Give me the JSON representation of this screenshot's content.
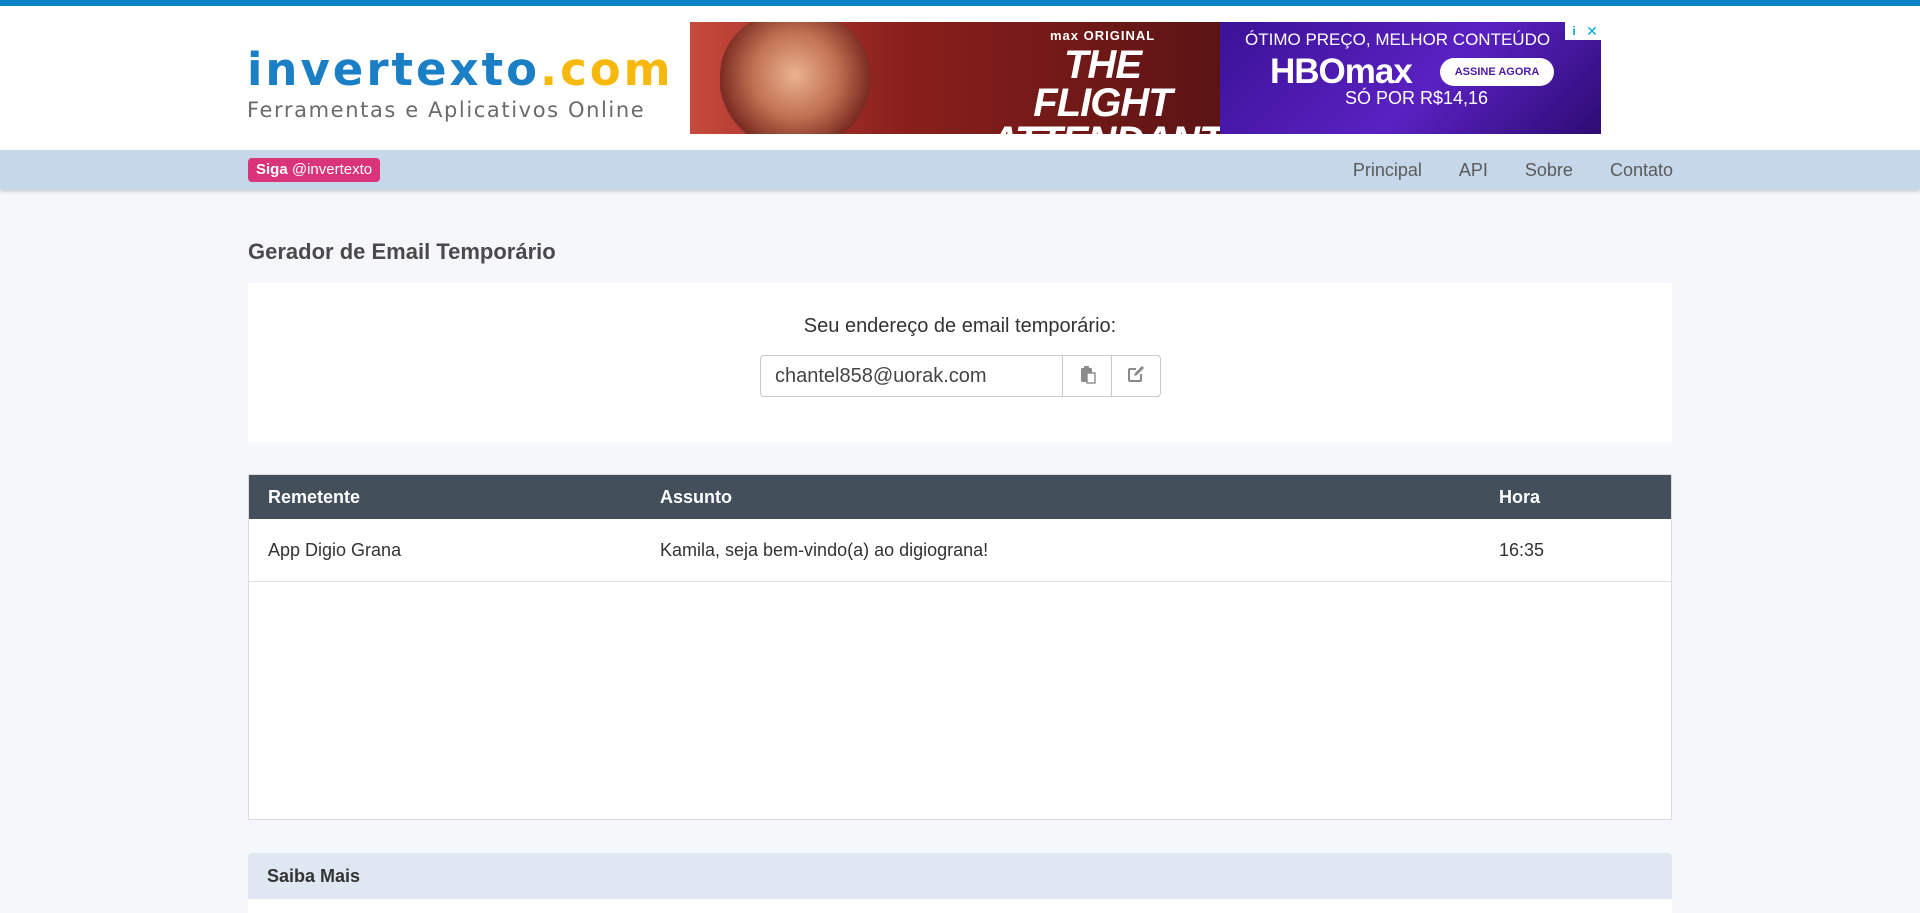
{
  "site": {
    "logo_part1": "invertexto",
    "logo_part2": ".com",
    "tagline": "Ferramentas e Aplicativos Online"
  },
  "ad": {
    "top_label": "max ORIGINAL",
    "show_title": "THE FLIGHT ATTENDANT",
    "promo": "ÓTIMO PREÇO, MELHOR CONTEÚDO",
    "brand": "HBOmax",
    "cta": "ASSINE AGORA",
    "price": "SÓ POR R$14,16",
    "info_icon": "info-icon",
    "close_icon": "close-icon"
  },
  "navbar": {
    "follow_bold": "Siga",
    "follow_handle": "@invertexto",
    "links": [
      "Principal",
      "API",
      "Sobre",
      "Contato"
    ]
  },
  "page": {
    "title": "Gerador de Email Temporário"
  },
  "email": {
    "label": "Seu endereço de email temporário:",
    "address": "chantel858@uorak.com",
    "copy_icon": "clipboard-icon",
    "edit_icon": "edit-icon"
  },
  "inbox": {
    "headers": [
      "Remetente",
      "Assunto",
      "Hora"
    ],
    "rows": [
      {
        "sender": "App Digio Grana",
        "subject": "Kamila, seja bem-vindo(a) ao digiograna!",
        "time": "16:35"
      }
    ]
  },
  "saiba": {
    "title": "Saiba Mais"
  }
}
